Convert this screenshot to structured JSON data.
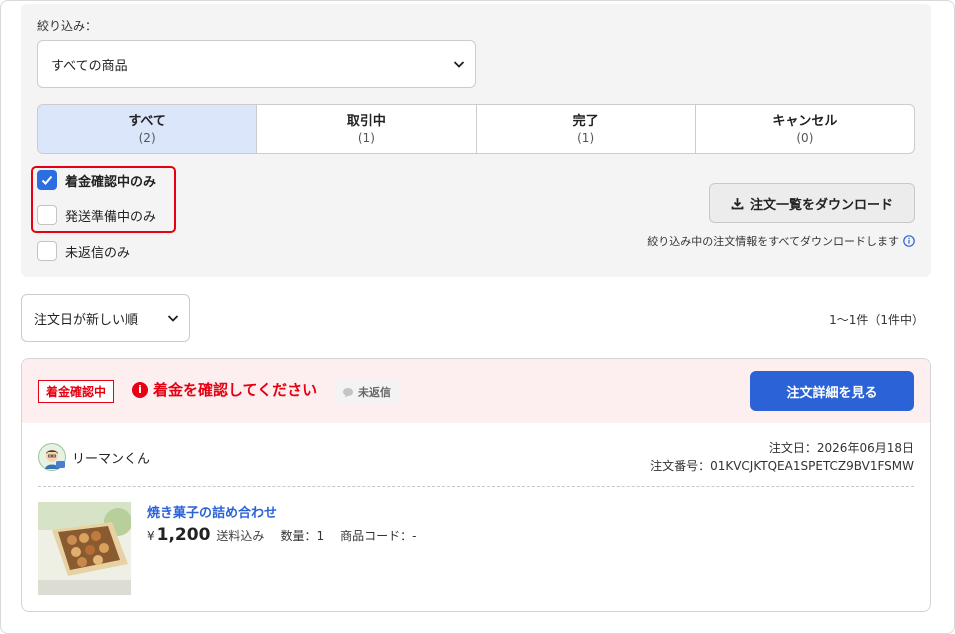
{
  "filter": {
    "label": "絞り込み：",
    "product_select_value": "すべての商品",
    "tabs": [
      {
        "label": "すべて",
        "count": "(2)",
        "active": true
      },
      {
        "label": "取引中",
        "count": "(1)",
        "active": false
      },
      {
        "label": "完了",
        "count": "(1)",
        "active": false
      },
      {
        "label": "キャンセル",
        "count": "(0)",
        "active": false
      }
    ],
    "checkboxes": [
      {
        "label": "着金確認中のみ",
        "checked": true
      },
      {
        "label": "発送準備中のみ",
        "checked": false
      },
      {
        "label": "未返信のみ",
        "checked": false
      }
    ],
    "download_button": "注文一覧をダウンロード",
    "download_note": "絞り込み中の注文情報をすべてダウンロードします"
  },
  "sort": {
    "value": "注文日が新しい順",
    "result_count": "1〜1件（1件中）"
  },
  "order": {
    "status_badge": "着金確認中",
    "alert_text": "着金を確認してください",
    "reply_badge": "未返信",
    "detail_button": "注文詳細を見る",
    "user_name": "リーマンくん",
    "order_date": "注文日：2026年06月18日",
    "order_number": "注文番号：01KVCJKTQEA1SPETCZ9BV1FSMW",
    "product_name": "焼き菓子の詰め合わせ",
    "currency": "¥",
    "price": "1,200",
    "shipping": "送料込み",
    "quantity": "数量：1",
    "product_code": "商品コード：-"
  },
  "colors": {
    "accent_blue": "#2b63d6",
    "alert_red": "#e60012",
    "active_tab_bg": "#dbe6fb",
    "card_header_bg": "#fdeff0"
  }
}
